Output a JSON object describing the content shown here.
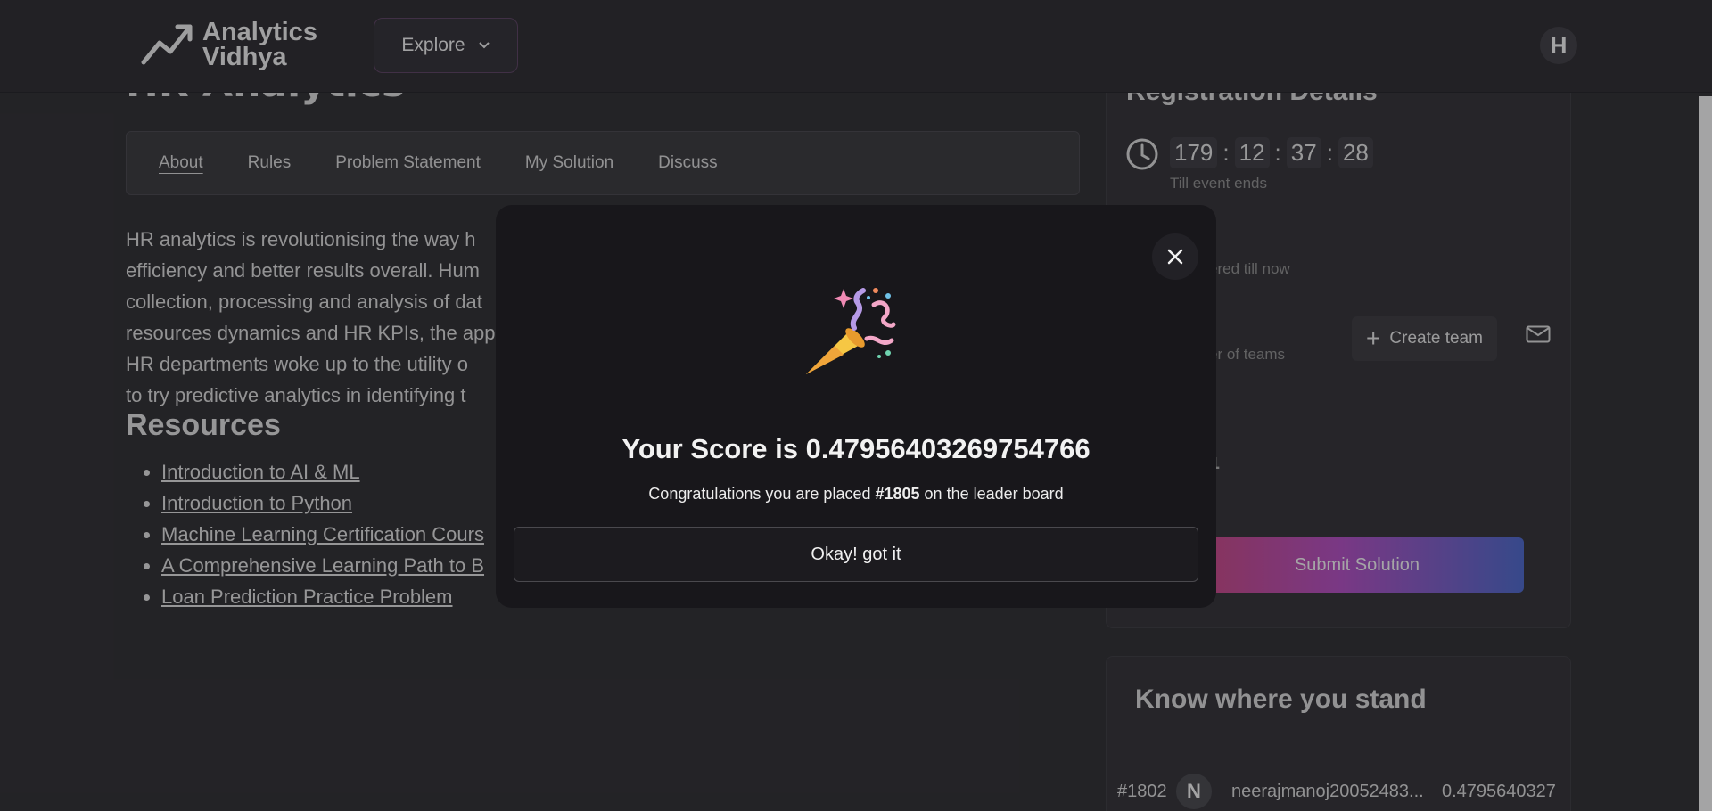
{
  "header": {
    "logo_line1": "Analytics",
    "logo_line2": "Vidhya",
    "explore_label": "Explore",
    "avatar_initial": "H"
  },
  "page": {
    "title": "HR Analytics",
    "tabs": [
      {
        "label": "About"
      },
      {
        "label": "Rules"
      },
      {
        "label": "Problem Statement"
      },
      {
        "label": "My Solution"
      },
      {
        "label": "Discuss"
      }
    ],
    "about_lines": [
      "HR analytics is revolutionising the way h",
      "efficiency and better results overall. Hum",
      "collection, processing and analysis of dat",
      "resources dynamics and HR KPIs, the app",
      "HR departments woke up to the utility o",
      "to try predictive analytics in identifying t"
    ],
    "resources_title": "Resources",
    "resources": [
      {
        "label": "Introduction to AI & ML"
      },
      {
        "label": "Introduction to Python"
      },
      {
        "label": "Machine Learning Certification Cours"
      },
      {
        "label": "A Comprehensive Learning Path to B"
      },
      {
        "label": "Loan Prediction Practice Problem"
      }
    ]
  },
  "registration": {
    "title": "Registration Details",
    "timer": {
      "days": "179",
      "hours": "12",
      "minutes": "37",
      "seconds": "28"
    },
    "till_label": "Till event ends",
    "registered_count_fragment": ")",
    "registered_sub": "ered till now",
    "teams_sub": "er of teams",
    "create_team_label": "Create team",
    "rank_fragment": "1",
    "submit_label": "Submit Solution"
  },
  "know_where": {
    "title": "Know where you stand",
    "row": {
      "rank": "#1802",
      "initial": "N",
      "name": "neerajmanoj20052483...",
      "score": "0.4795640327"
    }
  },
  "modal": {
    "score_prefix": "Your Score is ",
    "score_value": "0.47956403269754766",
    "congrats_prefix": "Congratulations you are placed ",
    "rank": "#1805",
    "congrats_suffix": " on the leader board",
    "ok_label": "Okay! got it"
  }
}
